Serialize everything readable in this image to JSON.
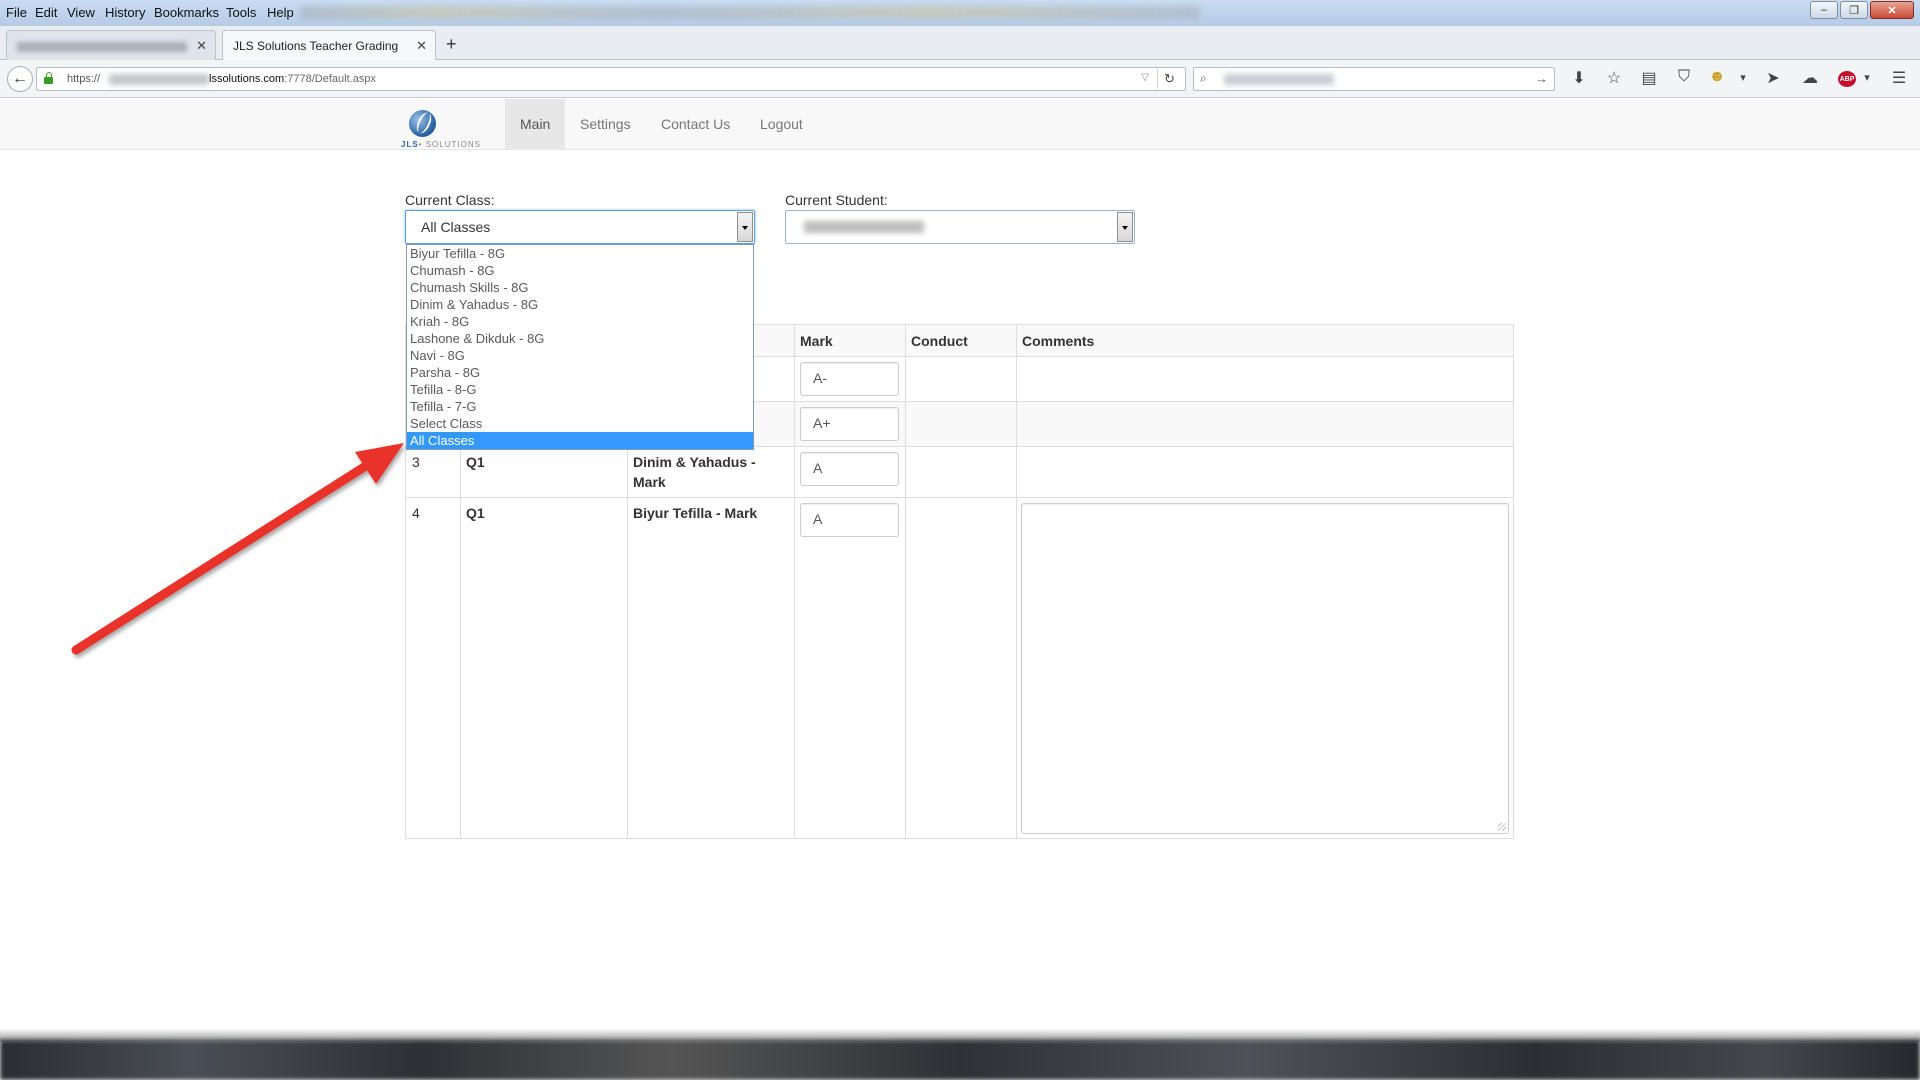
{
  "browser": {
    "menu": [
      "File",
      "Edit",
      "View",
      "History",
      "Bookmarks",
      "Tools",
      "Help"
    ],
    "window_controls": {
      "minimize": "–",
      "restore": "❐",
      "close": "✕"
    },
    "tabs": [
      {
        "label": ""
      },
      {
        "label": "JLS Solutions Teacher Grading",
        "active": true
      }
    ],
    "tab_close": "✕",
    "new_tab": "+",
    "url": {
      "protocol": "https://",
      "host": "lssolutions.com",
      "path": ":7778/Default.aspx"
    },
    "icons": {
      "back": "←",
      "dropmarker": "▽",
      "reload": "↻",
      "search": "⌕",
      "search_go": "→",
      "download": "⬇",
      "bookmark_star": "☆",
      "reading_list": "▤",
      "pocket": "⛉",
      "addon": "☻",
      "addon_menu": "▾",
      "send": "➤",
      "chat": "☁",
      "abp": "ABP",
      "hamburger": "☰"
    }
  },
  "site": {
    "logo": {
      "brand": "JLS",
      "tagline": "• SOLUTIONS"
    },
    "nav": [
      {
        "label": "Main",
        "active": true
      },
      {
        "label": "Settings"
      },
      {
        "label": "Contact Us"
      },
      {
        "label": "Logout"
      }
    ]
  },
  "form": {
    "class_label": "Current Class:",
    "class_value": "All Classes",
    "student_label": "Current Student:",
    "class_options": [
      "Biyur Tefilla - 8G",
      "Chumash - 8G",
      "Chumash Skills - 8G",
      "Dinim & Yahadus - 8G",
      "Kriah - 8G",
      "Lashone & Dikduk - 8G",
      "Navi - 8G",
      "Parsha - 8G",
      "Tefilla - 8-G",
      "Tefilla - 7-G",
      "Select Class",
      "All Classes"
    ],
    "selected_option_index": 11
  },
  "table": {
    "headers": {
      "mark": "Mark",
      "conduct": "Conduct",
      "comments": "Comments"
    },
    "rows": [
      {
        "num": "",
        "quarter": "",
        "subject_line1": "",
        "subject_line2": "",
        "mark": "A-"
      },
      {
        "num": "",
        "quarter": "",
        "subject_line1": "",
        "subject_line2": "",
        "mark": "A+"
      },
      {
        "num": "3",
        "quarter": "Q1",
        "subject_line1": "Dinim & Yahadus -",
        "subject_line2": "Mark",
        "mark": "A"
      },
      {
        "num": "4",
        "quarter": "Q1",
        "subject_line1": "Biyur Tefilla - Mark",
        "subject_line2": "",
        "mark": "A"
      }
    ]
  },
  "colors": {
    "annotation_arrow": "#e8302c",
    "selected_option": "#3399ff",
    "focus_border": "#5b9ee0",
    "navbar_bg": "#f8f8f8"
  }
}
